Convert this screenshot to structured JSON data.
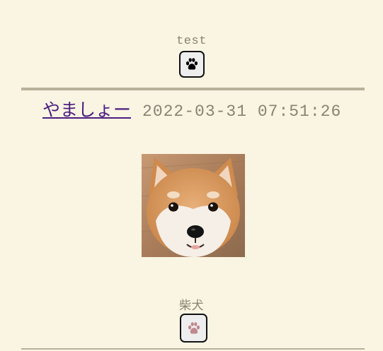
{
  "previous_post": {
    "caption": "test",
    "like_button": {
      "icon": "paw-icon",
      "color": "#000000"
    }
  },
  "post": {
    "username": "やましょー",
    "timestamp": "2022-03-31 07:51:26",
    "image": {
      "subject": "shiba-inu-face-photo"
    },
    "caption": "柴犬",
    "like_button": {
      "icon": "paw-icon",
      "color": "#c0878e"
    }
  },
  "colors": {
    "background": "#faf4e3",
    "divider": "#b8b09a",
    "muted_text": "#8a8272",
    "username_link": "#4b1d7e"
  }
}
